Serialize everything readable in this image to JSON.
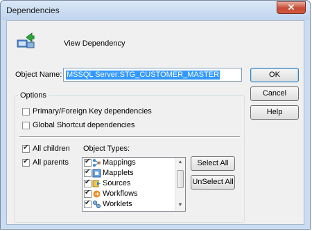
{
  "window": {
    "title": "Dependencies",
    "close_glyph": "✕"
  },
  "header": {
    "text": "View Dependency",
    "icon": "view-dependency-icon"
  },
  "object_name": {
    "label": "Object Name:",
    "value": "MSSQL Server:STG_CUSTOMER_MASTER"
  },
  "buttons": {
    "ok": "OK",
    "cancel": "Cancel",
    "help": "Help",
    "select_all": "Select All",
    "unselect_all": "UnSelect All"
  },
  "options": {
    "title": "Options",
    "primary_foreign": {
      "label": "Primary/Foreign Key dependencies",
      "checked": false
    },
    "global_shortcut": {
      "label": "Global Shortcut dependencies",
      "checked": false
    },
    "all_children": {
      "label": "All children",
      "checked": true
    },
    "all_parents": {
      "label": "All parents",
      "checked": true
    }
  },
  "object_types": {
    "label": "Object Types:",
    "items": [
      {
        "label": "Mappings",
        "checked": true,
        "icon": "mapping-icon"
      },
      {
        "label": "Mapplets",
        "checked": true,
        "icon": "mapplet-icon"
      },
      {
        "label": "Sources",
        "checked": true,
        "icon": "source-icon"
      },
      {
        "label": "Workflows",
        "checked": true,
        "icon": "workflow-icon"
      },
      {
        "label": "Worklets",
        "checked": true,
        "icon": "worklet-icon"
      }
    ]
  }
}
